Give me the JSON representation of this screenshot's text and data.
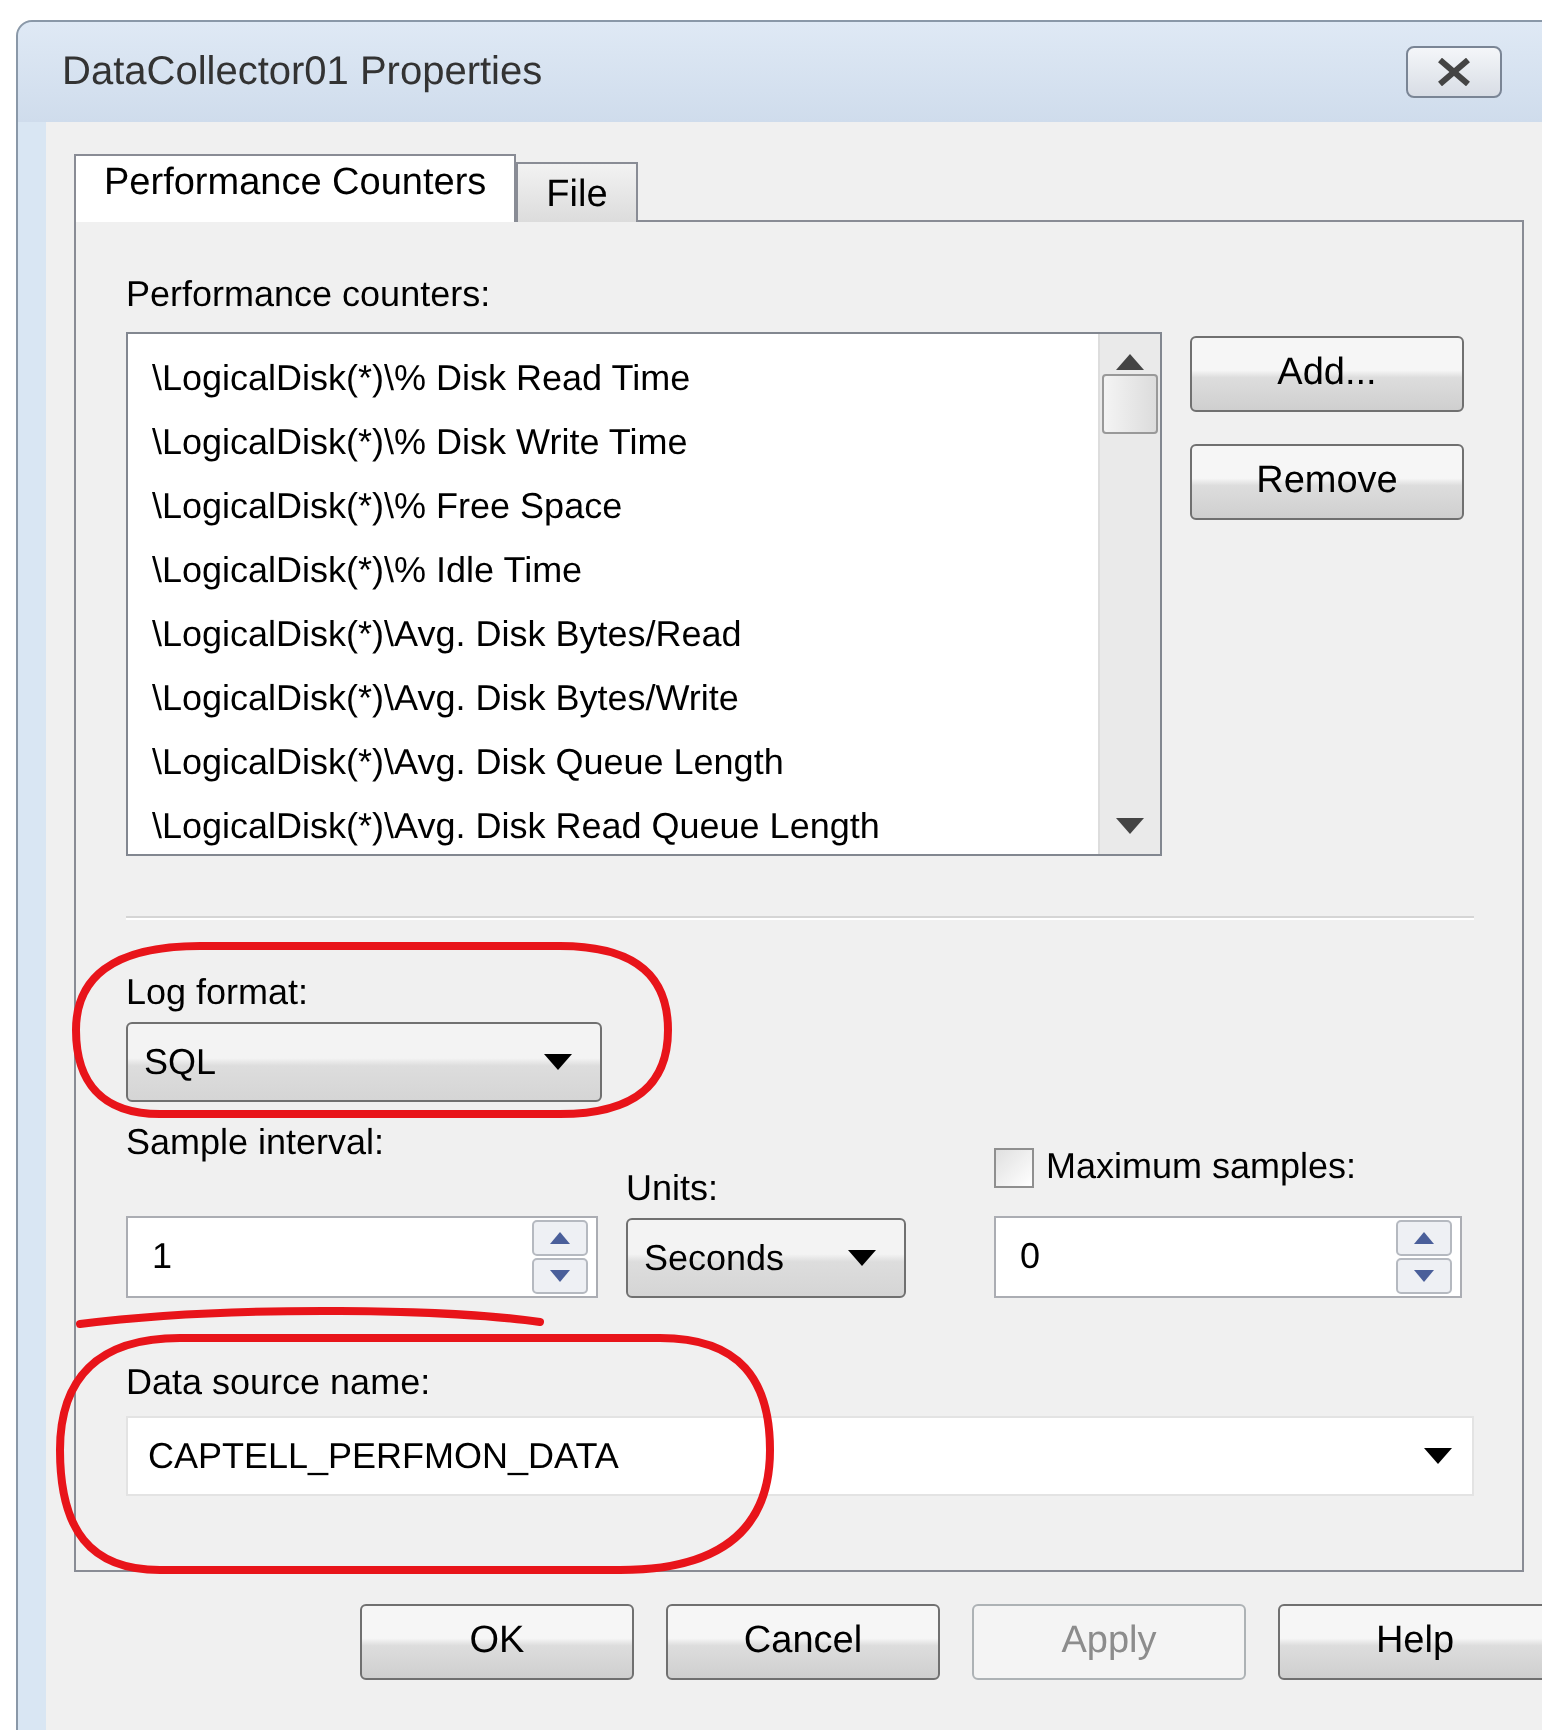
{
  "window": {
    "title": "DataCollector01 Properties"
  },
  "tabs": [
    {
      "label": "Performance Counters",
      "selected": true
    },
    {
      "label": "File",
      "selected": false
    }
  ],
  "counters": {
    "label": "Performance counters:",
    "items": [
      "\\LogicalDisk(*)\\% Disk Read Time",
      "\\LogicalDisk(*)\\% Disk Write Time",
      "\\LogicalDisk(*)\\% Free Space",
      "\\LogicalDisk(*)\\% Idle Time",
      "\\LogicalDisk(*)\\Avg. Disk Bytes/Read",
      "\\LogicalDisk(*)\\Avg. Disk Bytes/Write",
      "\\LogicalDisk(*)\\Avg. Disk Queue Length",
      "\\LogicalDisk(*)\\Avg. Disk Read Queue Length"
    ]
  },
  "counter_buttons": [
    {
      "label": "Add..."
    },
    {
      "label": "Remove"
    }
  ],
  "log_format": {
    "label": "Log format:",
    "value": "SQL"
  },
  "sample_interval": {
    "label": "Sample interval:",
    "value": "1"
  },
  "units": {
    "label": "Units:",
    "value": "Seconds"
  },
  "maximum_samples": {
    "label": "Maximum samples:",
    "checked": false,
    "value": "0"
  },
  "data_source_name": {
    "label": "Data source name:",
    "value": "CAPTELL_PERFMON_DATA"
  },
  "buttons": [
    {
      "label": "OK",
      "disabled": false
    },
    {
      "label": "Cancel",
      "disabled": false
    },
    {
      "label": "Apply",
      "disabled": true
    },
    {
      "label": "Help",
      "disabled": false
    }
  ]
}
